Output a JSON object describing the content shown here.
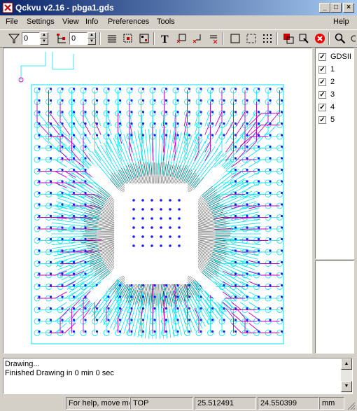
{
  "window": {
    "title": "Qckvu v2.16 - pbga1.gds"
  },
  "menu": {
    "items": [
      "File",
      "Settings",
      "View",
      "Info",
      "Preferences",
      "Tools"
    ],
    "help": "Help"
  },
  "toolbar": {
    "filter_level": "0",
    "hierarchy_level": "0"
  },
  "layers": {
    "items": [
      {
        "label": "GDSII",
        "checked": true
      },
      {
        "label": "1",
        "checked": true
      },
      {
        "label": "2",
        "checked": true
      },
      {
        "label": "3",
        "checked": true
      },
      {
        "label": "4",
        "checked": true
      },
      {
        "label": "5",
        "checked": true
      }
    ]
  },
  "log": {
    "lines": [
      "Drawing...",
      "Finished Drawing in 0 min 0 sec"
    ]
  },
  "status": {
    "help": "For help, move mo",
    "cell": "TOP",
    "x": "25.512491",
    "y": "24.550399",
    "units": "mm"
  },
  "colors": {
    "cyan": "#00e5ee",
    "magenta": "#c000c0",
    "blue": "#1a1aff",
    "black": "#000000"
  },
  "icons": [
    "filter-icon",
    "hierarchy-icon",
    "layers-icon",
    "select-icon",
    "grid-icon",
    "text-icon",
    "move-icon",
    "corner-icon",
    "delete-icon",
    "box-icon",
    "dotted-box-icon",
    "dots-icon",
    "copy-icon",
    "edit-icon",
    "stop-icon",
    "zoom-icon"
  ]
}
